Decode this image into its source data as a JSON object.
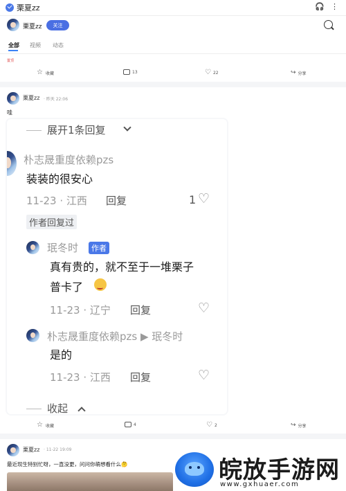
{
  "app": {
    "title": "栗夏zz",
    "icons": [
      "headphones-icon",
      "more-icon"
    ]
  },
  "profile": {
    "name": "栗夏zz",
    "follow_label": "关注"
  },
  "tabs": [
    {
      "label": "全部",
      "active": true
    },
    {
      "label": "视频",
      "active": false
    },
    {
      "label": "动态",
      "active": false
    }
  ],
  "top_post": {
    "red_text": "置顶",
    "actions": {
      "collect": "收藏",
      "comments": "13",
      "likes": "22",
      "share": "分享"
    }
  },
  "post1": {
    "author": "栗夏zz",
    "time": "· 昨天 22:06",
    "text": "哇",
    "embed": {
      "expand_label": "展开1条回复",
      "comment": {
        "author": "朴志晟重度依赖pzs",
        "text": "装装的很安心",
        "meta": "11-23 · 江西",
        "reply": "回复",
        "likes": "1",
        "author_tag": "作者回复过"
      },
      "reply1": {
        "author": "珉冬时",
        "badge": "作者",
        "text_line1": "真有贵的，就不至于一堆栗子",
        "text_line2": "普卡了",
        "meta": "11-23 · 辽宁",
        "reply": "回复"
      },
      "reply2": {
        "author": "朴志晟重度依赖pzs ▶ 珉冬时",
        "text": "是的",
        "meta": "11-23 · 江西",
        "reply": "回复"
      },
      "collapse_label": "收起"
    },
    "actions": {
      "collect": "收藏",
      "comments": "4",
      "likes": "2",
      "share": "分享"
    }
  },
  "post2": {
    "author": "栗夏zz",
    "time": "· 11-22 19:09",
    "text": "最近现生特别忙呀，一直没更，问问你萌想看什么🤔"
  },
  "watermark": {
    "cn": "皖放手游网",
    "url": "www.gxhuaer.com"
  },
  "colors": {
    "accent": "#4a6fe3",
    "tab_underline": "#3b82f6",
    "watermark_blue": "#1f6fe5"
  }
}
